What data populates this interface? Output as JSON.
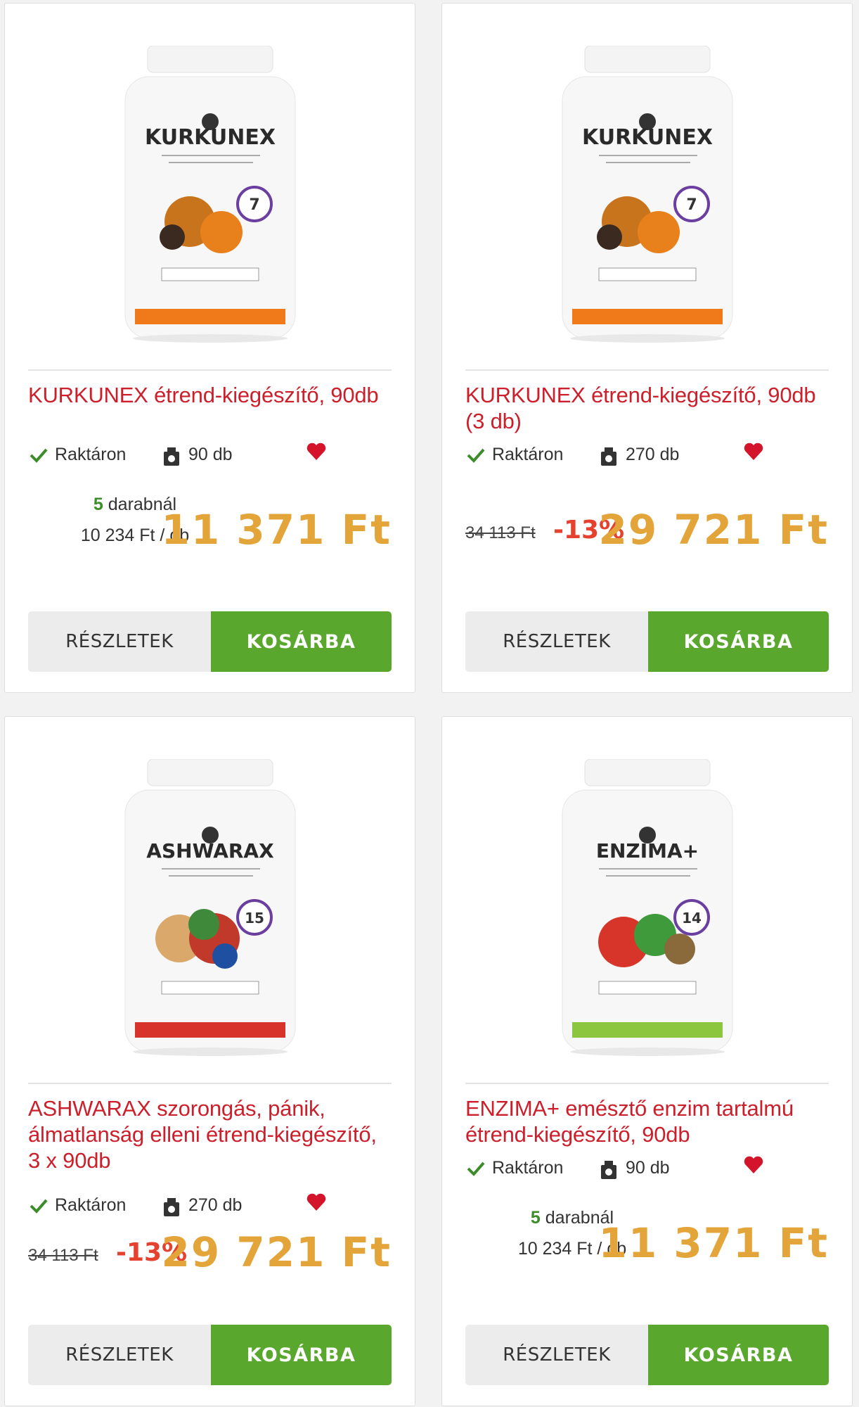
{
  "products": [
    {
      "brand": "KURKUNEX",
      "title": "KURKUNEX étrend-kiegészítő, 90db",
      "stock": "Raktáron",
      "qty": "90 db",
      "bulk_count": "5",
      "bulk_suffix": " darabnál",
      "bulk_price": "10 234 Ft / db",
      "old_price": "",
      "discount": "",
      "price": "11 371 Ft",
      "details_label": "RÉSZLETEK",
      "cart_label": "KOSÁRBA",
      "badge": "7",
      "label_color": "#f07a1a"
    },
    {
      "brand": "KURKUNEX",
      "title": "KURKUNEX étrend-kiegészítő, 90db (3 db)",
      "stock": "Raktáron",
      "qty": "270 db",
      "bulk_count": "",
      "bulk_suffix": "",
      "bulk_price": "",
      "old_price": "34 113 Ft",
      "discount": "-13%",
      "price": "29 721 Ft",
      "details_label": "RÉSZLETEK",
      "cart_label": "KOSÁRBA",
      "badge": "7",
      "label_color": "#f07a1a"
    },
    {
      "brand": "ASHWARAX",
      "title": "ASHWARAX szorongás, pánik, álmatlanság elleni étrend-kiegészítő, 3 x 90db",
      "stock": "Raktáron",
      "qty": "270 db",
      "bulk_count": "",
      "bulk_suffix": "",
      "bulk_price": "",
      "old_price": "34 113 Ft",
      "discount": "-13%",
      "price": "29 721 Ft",
      "details_label": "RÉSZLETEK",
      "cart_label": "KOSÁRBA",
      "badge": "15",
      "label_color": "#d8332a"
    },
    {
      "brand": "ENZIMA+",
      "title": "ENZIMA+ emésztő enzim tartalmú étrend-kiegészítő, 90db",
      "stock": "Raktáron",
      "qty": "90 db",
      "bulk_count": "5",
      "bulk_suffix": " darabnál",
      "bulk_price": "10 234 Ft / db",
      "old_price": "",
      "discount": "",
      "price": "11 371 Ft",
      "details_label": "RÉSZLETEK",
      "cart_label": "KOSÁRBA",
      "badge": "14",
      "label_color": "#8cc63f"
    }
  ],
  "colors": {
    "title": "#cc1f2b",
    "price": "#e3a43a",
    "discount": "#e4412e",
    "cart_button": "#59a72c",
    "heart": "#d4142a",
    "check": "#3d8c2a"
  },
  "icons": [
    "check-icon",
    "box-icon",
    "heart-icon"
  ]
}
